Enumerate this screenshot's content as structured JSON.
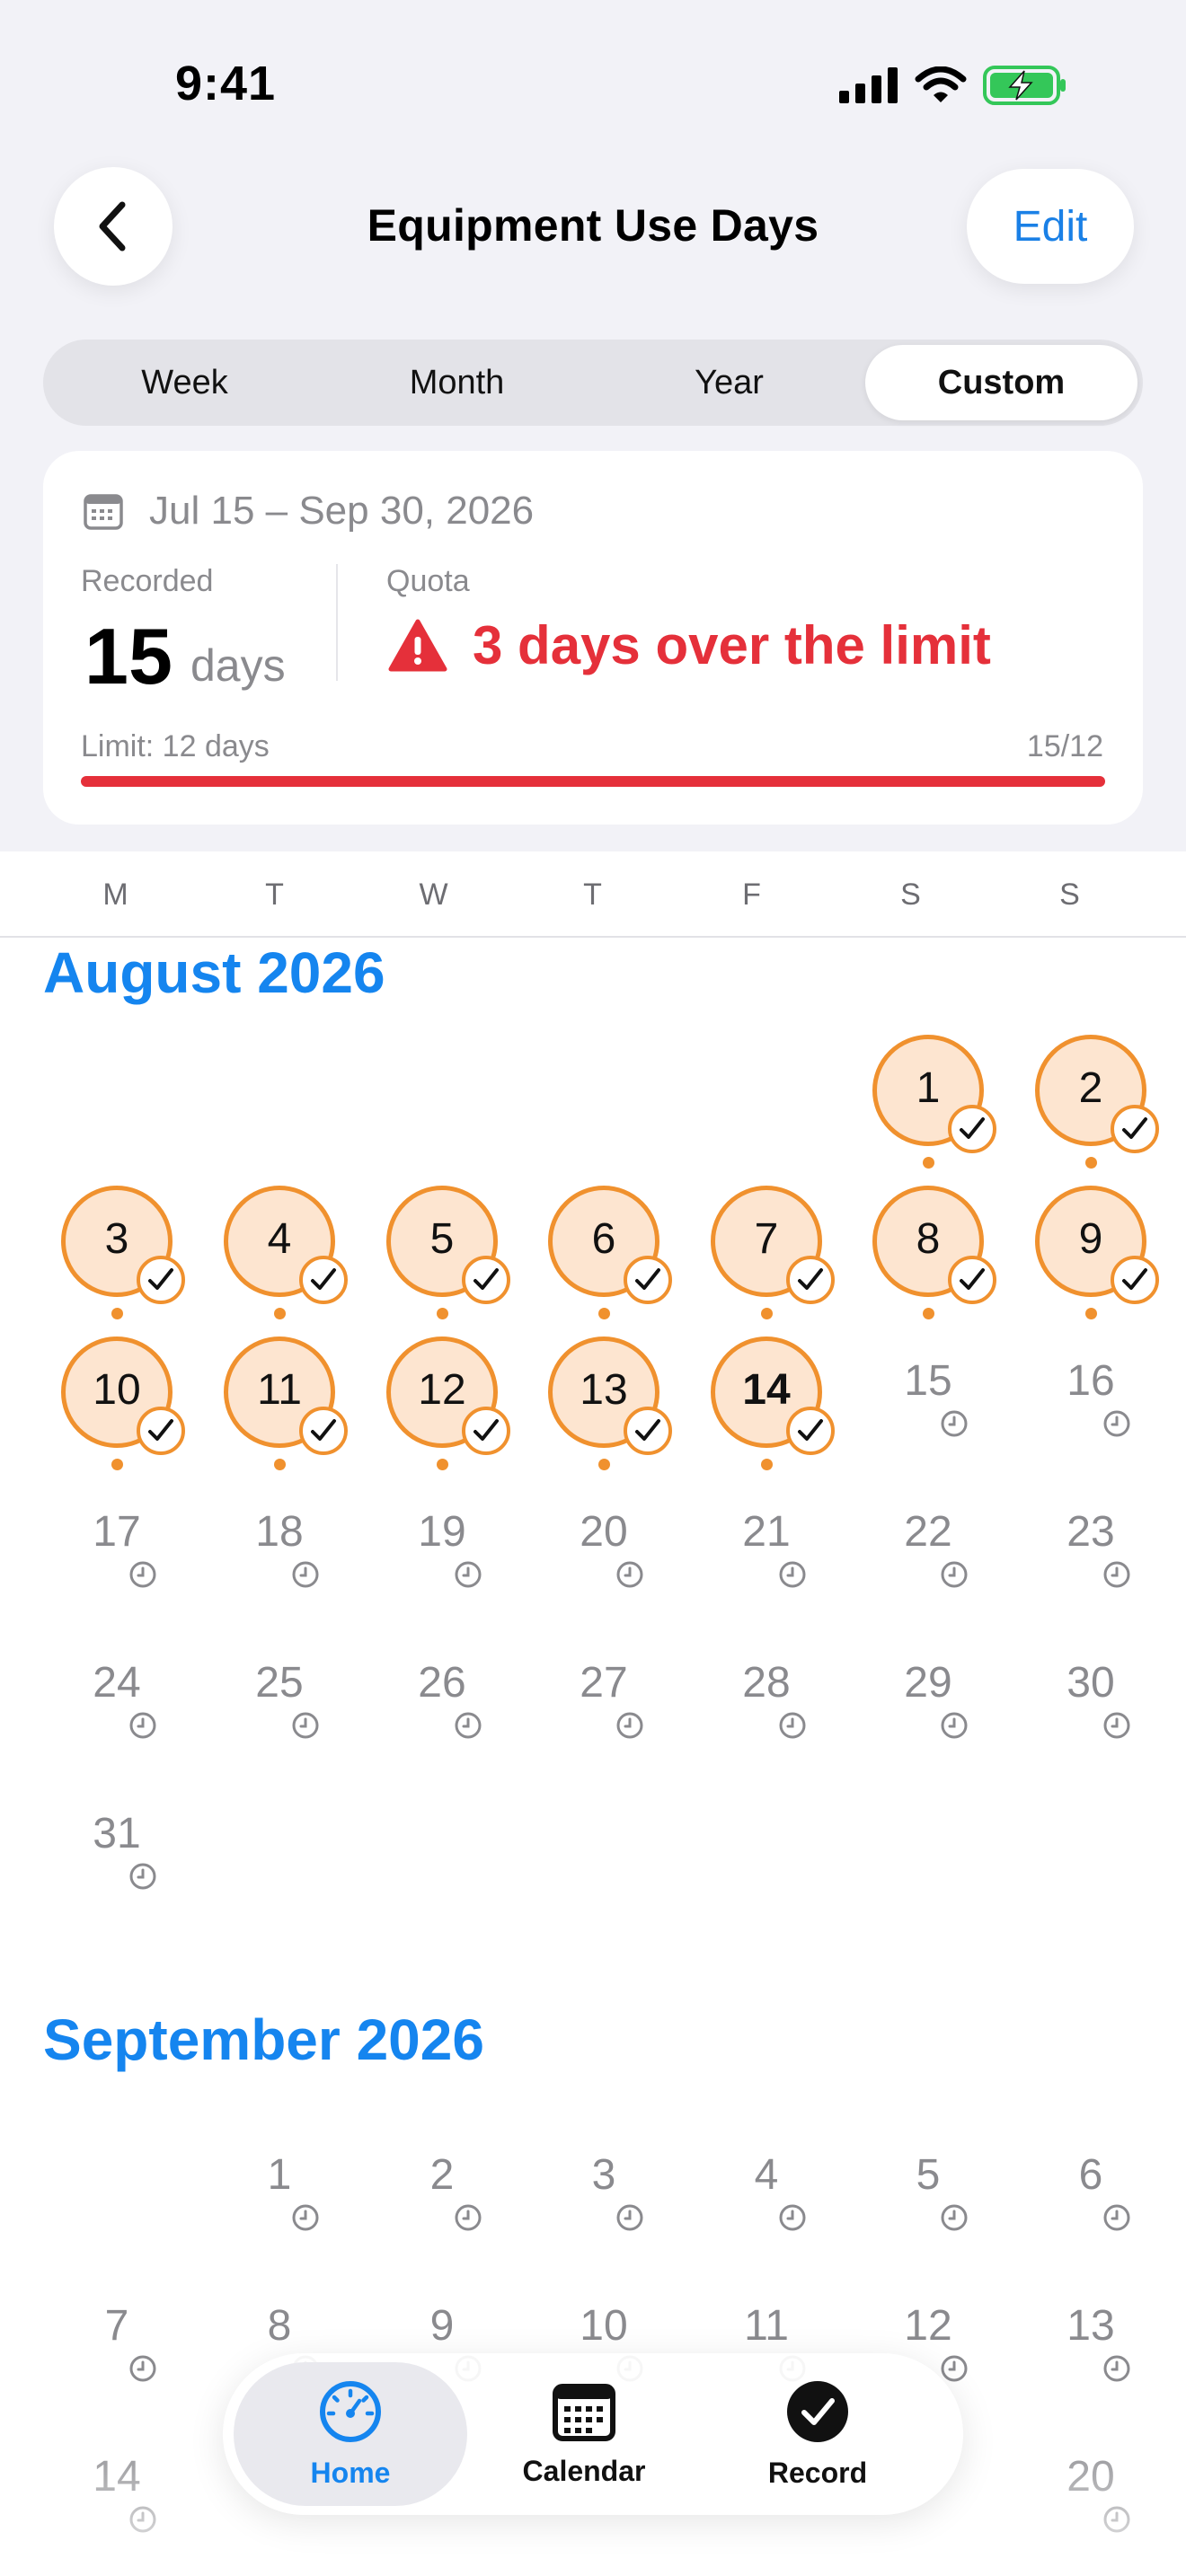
{
  "status_bar": {
    "time": "9:41"
  },
  "nav": {
    "title": "Equipment Use Days",
    "edit_label": "Edit"
  },
  "segments": [
    "Week",
    "Month",
    "Year",
    "Custom"
  ],
  "active_segment": "Custom",
  "summary": {
    "date_range": "Jul 15 – Sep 30, 2026",
    "recorded_label": "Recorded",
    "recorded_value": "15",
    "recorded_unit": "days",
    "quota_label": "Quota",
    "quota_status": "3 days over the limit",
    "limit_label": "Limit: 12 days",
    "limit_count": "15/12",
    "progress_fraction": 1.0
  },
  "weekdays": [
    "M",
    "T",
    "W",
    "T",
    "F",
    "S",
    "S"
  ],
  "months": [
    {
      "title": "August 2026",
      "days": [
        {
          "day": "1",
          "state": "recorded"
        },
        {
          "day": "2",
          "state": "recorded"
        },
        {
          "day": "3",
          "state": "recorded"
        },
        {
          "day": "4",
          "state": "recorded"
        },
        {
          "day": "5",
          "state": "recorded"
        },
        {
          "day": "6",
          "state": "recorded"
        },
        {
          "day": "7",
          "state": "recorded"
        },
        {
          "day": "8",
          "state": "recorded"
        },
        {
          "day": "9",
          "state": "recorded"
        },
        {
          "day": "10",
          "state": "recorded"
        },
        {
          "day": "11",
          "state": "recorded"
        },
        {
          "day": "12",
          "state": "recorded"
        },
        {
          "day": "13",
          "state": "recorded"
        },
        {
          "day": "14",
          "state": "recorded",
          "today": true
        },
        {
          "day": "15",
          "state": "pending"
        },
        {
          "day": "16",
          "state": "pending"
        },
        {
          "day": "17",
          "state": "pending"
        },
        {
          "day": "18",
          "state": "pending"
        },
        {
          "day": "19",
          "state": "pending"
        },
        {
          "day": "20",
          "state": "pending"
        },
        {
          "day": "21",
          "state": "pending"
        },
        {
          "day": "22",
          "state": "pending"
        },
        {
          "day": "23",
          "state": "pending"
        },
        {
          "day": "24",
          "state": "pending"
        },
        {
          "day": "25",
          "state": "pending"
        },
        {
          "day": "26",
          "state": "pending"
        },
        {
          "day": "27",
          "state": "pending"
        },
        {
          "day": "28",
          "state": "pending"
        },
        {
          "day": "29",
          "state": "pending"
        },
        {
          "day": "30",
          "state": "pending"
        },
        {
          "day": "31",
          "state": "pending"
        }
      ]
    },
    {
      "title": "September 2026",
      "days": [
        {
          "day": "1",
          "state": "pending"
        },
        {
          "day": "2",
          "state": "pending"
        },
        {
          "day": "3",
          "state": "pending"
        },
        {
          "day": "4",
          "state": "pending"
        },
        {
          "day": "5",
          "state": "pending"
        },
        {
          "day": "6",
          "state": "pending"
        },
        {
          "day": "7",
          "state": "pending"
        },
        {
          "day": "8",
          "state": "pending"
        },
        {
          "day": "9",
          "state": "pending"
        },
        {
          "day": "10",
          "state": "pending"
        },
        {
          "day": "11",
          "state": "pending"
        },
        {
          "day": "12",
          "state": "pending"
        },
        {
          "day": "13",
          "state": "pending"
        },
        {
          "day": "14",
          "state": "pending"
        },
        {
          "day": "20",
          "state": "pending"
        }
      ]
    }
  ],
  "tabbar": {
    "home": "Home",
    "calendar": "Calendar",
    "record": "Record"
  },
  "colors": {
    "accent": "#1585ef",
    "recorded_fill": "#fde5d0",
    "recorded_ring": "#f0912e",
    "alert": "#e5303a",
    "battery": "#34c759"
  },
  "icons": [
    "back-chevron-icon",
    "calendar-icon",
    "warning-icon",
    "check-icon",
    "clock-icon",
    "speedometer-icon",
    "calendar-grid-icon",
    "checkmark-circle-icon",
    "signal-icon",
    "wifi-icon",
    "battery-icon"
  ]
}
